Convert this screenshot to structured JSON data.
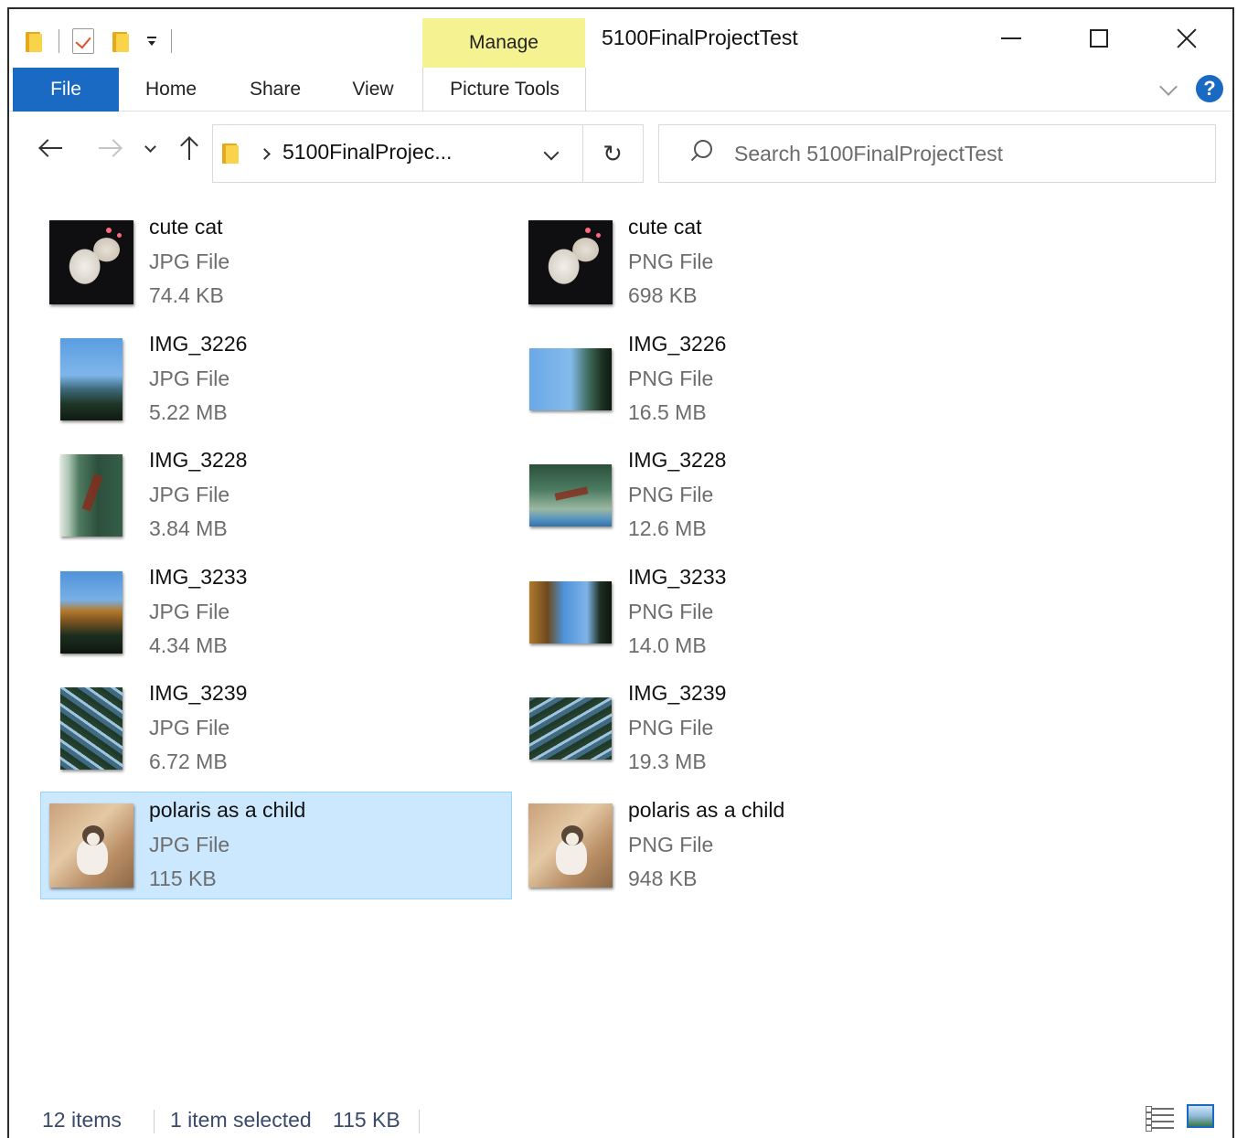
{
  "window": {
    "title": "5100FinalProjectTest",
    "context_tab": "Manage",
    "accent_color": "#1a69c2",
    "context_tab_color": "#f4f291"
  },
  "quick_access": {
    "icons": [
      "folder-icon",
      "properties-check-icon",
      "new-folder-icon",
      "customize-dropdown-icon"
    ]
  },
  "ribbon": {
    "tabs": [
      {
        "label": "File",
        "active": true
      },
      {
        "label": "Home"
      },
      {
        "label": "Share"
      },
      {
        "label": "View"
      },
      {
        "label": "Picture Tools"
      }
    ],
    "help_label": "?"
  },
  "nav": {
    "breadcrumb": "5100FinalProjec...",
    "refresh_glyph": "↻",
    "search_placeholder": "Search 5100FinalProjectTest"
  },
  "files": [
    {
      "name": "cute cat",
      "type": "JPG File",
      "size": "74.4 KB",
      "thumb": "cat",
      "selected": false
    },
    {
      "name": "cute cat",
      "type": "PNG File",
      "size": "698 KB",
      "thumb": "cat",
      "selected": false
    },
    {
      "name": "IMG_3226",
      "type": "JPG File",
      "size": "5.22 MB",
      "thumb": "sky-portrait",
      "selected": false
    },
    {
      "name": "IMG_3226",
      "type": "PNG File",
      "size": "16.5 MB",
      "thumb": "sky-landscape",
      "selected": false
    },
    {
      "name": "IMG_3228",
      "type": "JPG File",
      "size": "3.84 MB",
      "thumb": "glass-portrait",
      "selected": false
    },
    {
      "name": "IMG_3228",
      "type": "PNG File",
      "size": "12.6 MB",
      "thumb": "glass-landscape",
      "selected": false
    },
    {
      "name": "IMG_3233",
      "type": "JPG File",
      "size": "4.34 MB",
      "thumb": "building-portrait",
      "selected": false
    },
    {
      "name": "IMG_3233",
      "type": "PNG File",
      "size": "14.0 MB",
      "thumb": "building-landscape",
      "selected": false
    },
    {
      "name": "IMG_3239",
      "type": "JPG File",
      "size": "6.72 MB",
      "thumb": "tree-portrait",
      "selected": false
    },
    {
      "name": "IMG_3239",
      "type": "PNG File",
      "size": "19.3 MB",
      "thumb": "tree-landscape",
      "selected": false
    },
    {
      "name": "polaris as a child",
      "type": "JPG File",
      "size": "115 KB",
      "thumb": "kitten",
      "selected": true
    },
    {
      "name": "polaris as a child",
      "type": "PNG File",
      "size": "948 KB",
      "thumb": "kitten",
      "selected": false
    }
  ],
  "status": {
    "item_count": "12 items",
    "selected": "1 item selected",
    "selected_size": "115 KB"
  }
}
